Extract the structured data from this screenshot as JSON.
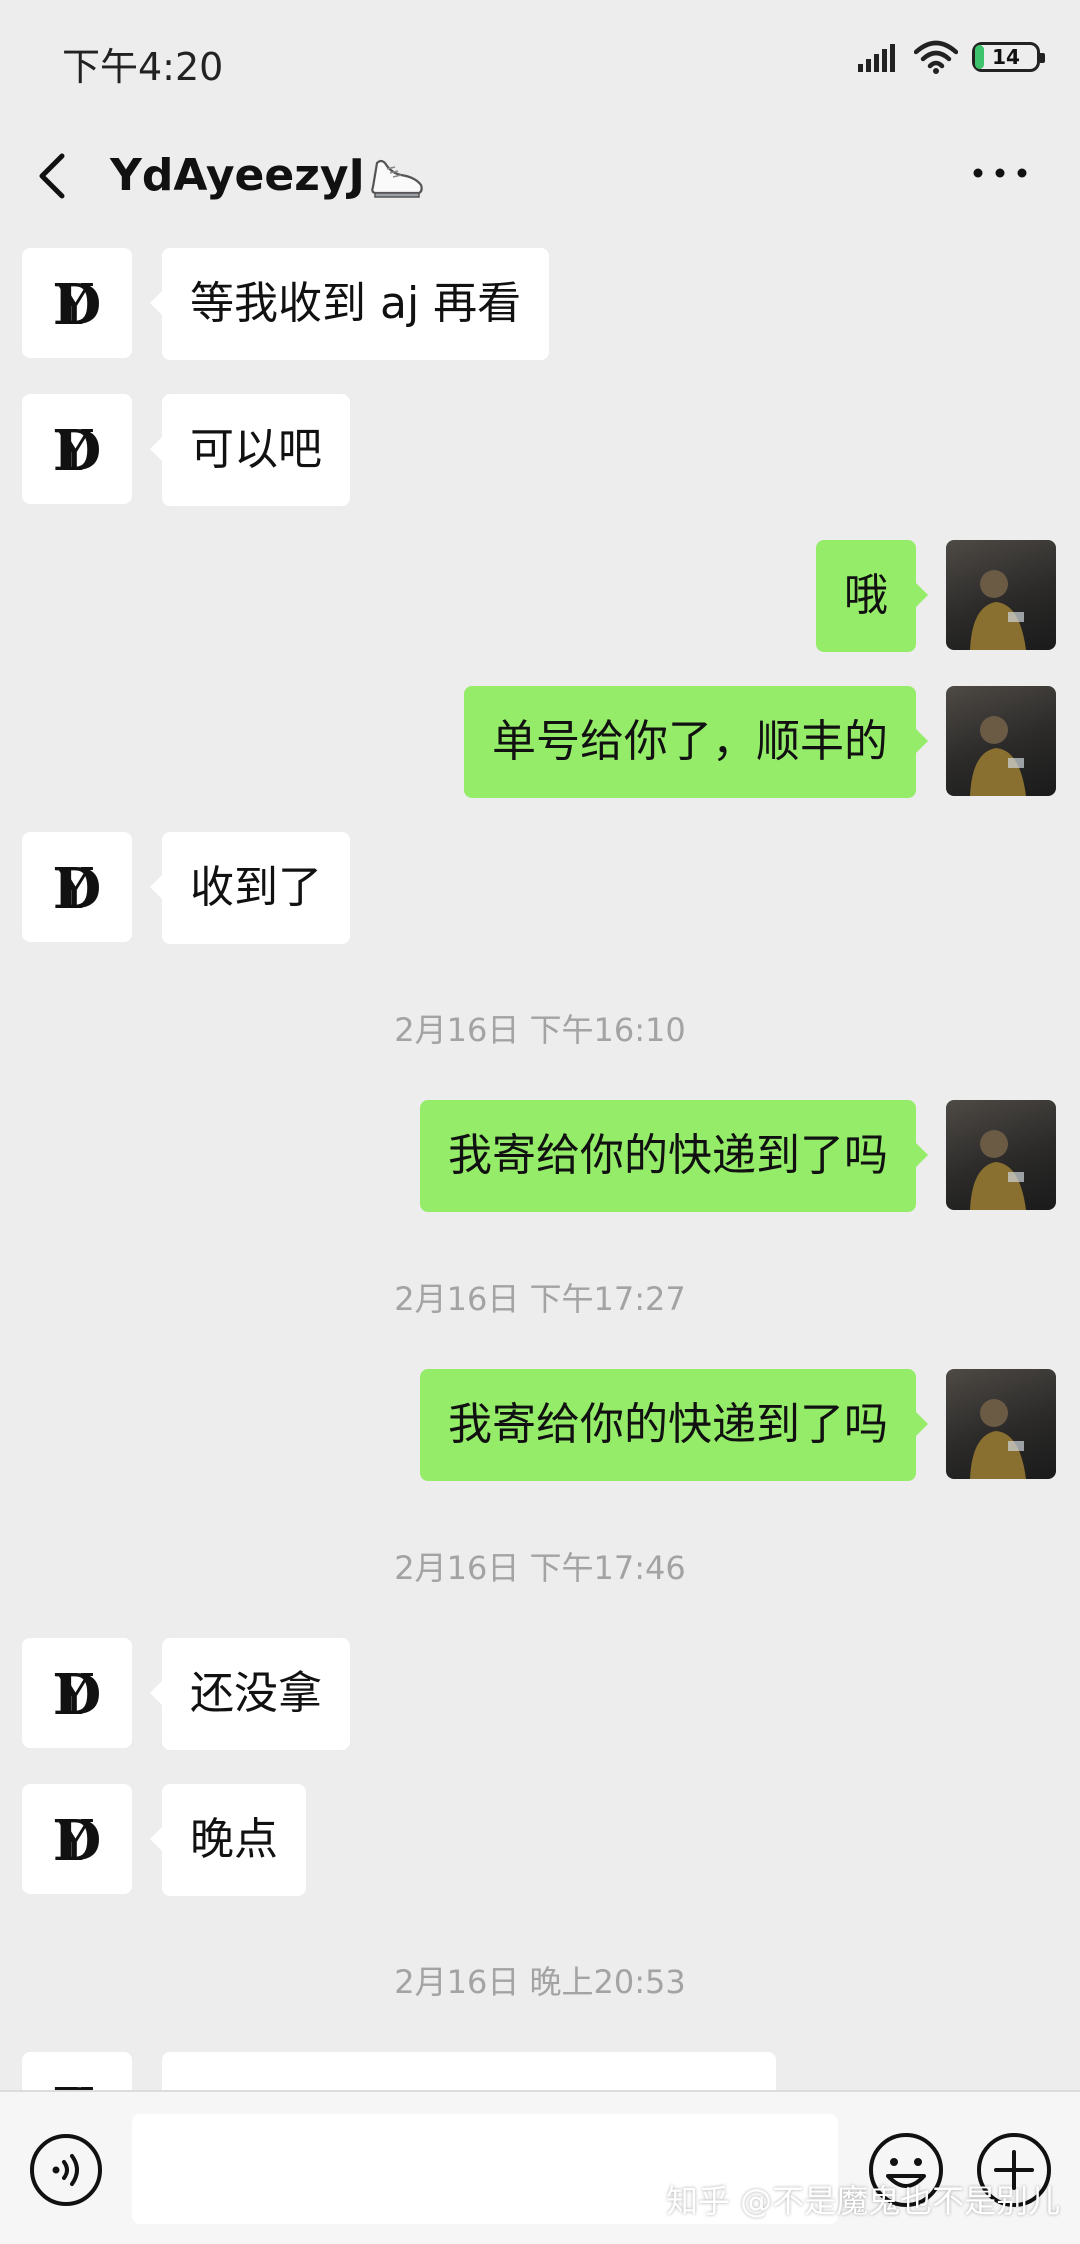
{
  "status_bar": {
    "time": "下午4:20",
    "battery_level": "14",
    "icons": [
      "signal-icon",
      "wifi-icon",
      "battery-icon"
    ]
  },
  "nav": {
    "title": "YdAyeezyJ",
    "title_emoji_icon": "shoe-icon",
    "icons": [
      "back-icon",
      "more-icon"
    ]
  },
  "messages": [
    {
      "side": "left",
      "text": "等我收到 aj 再看"
    },
    {
      "side": "left",
      "text": "可以吧"
    },
    {
      "side": "right",
      "text": "哦"
    },
    {
      "side": "right",
      "text": "单号给你了，顺丰的"
    },
    {
      "side": "left",
      "text": "收到了"
    },
    {
      "timestamp": "2月16日 下午16:10"
    },
    {
      "side": "right",
      "text": "我寄给你的快递到了吗"
    },
    {
      "timestamp": "2月16日 下午17:27"
    },
    {
      "side": "right",
      "text": "我寄给你的快递到了吗"
    },
    {
      "timestamp": "2月16日 下午17:46"
    },
    {
      "side": "left",
      "text": "还没拿"
    },
    {
      "side": "left",
      "text": "晚点"
    },
    {
      "timestamp": "2月16日 晚上20:53"
    }
  ],
  "input_bar": {
    "value": "",
    "icons": [
      "voice-icon",
      "emoji-icon",
      "plus-icon"
    ]
  },
  "watermark": "知乎 @不是魔鬼也不是别儿",
  "colors": {
    "background": "#ededed",
    "bubble_sent": "#95ec69",
    "bubble_received": "#ffffff",
    "timestamp": "#a3a3a3",
    "battery_fill": "#3cc36b"
  }
}
